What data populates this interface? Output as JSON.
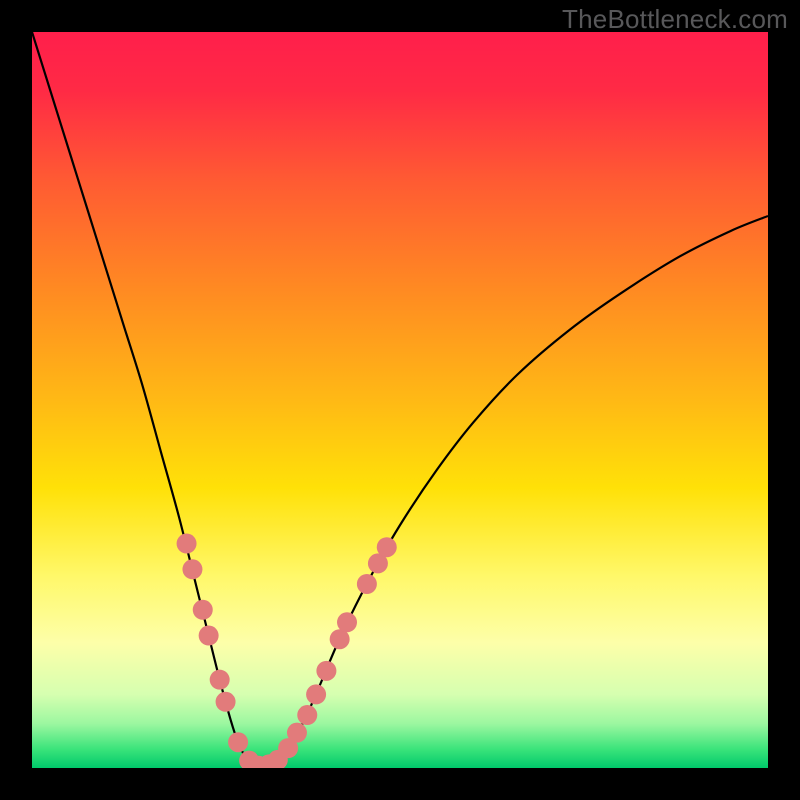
{
  "source_watermark": "TheBottleneck.com",
  "chart_data": {
    "type": "line",
    "title": "",
    "xlabel": "",
    "ylabel": "",
    "xlim": [
      0,
      100
    ],
    "ylim": [
      0,
      100
    ],
    "background_gradient_stops": [
      {
        "offset": 0.0,
        "color": "#ff1f4b"
      },
      {
        "offset": 0.08,
        "color": "#ff2a45"
      },
      {
        "offset": 0.2,
        "color": "#ff5a33"
      },
      {
        "offset": 0.35,
        "color": "#ff8a22"
      },
      {
        "offset": 0.5,
        "color": "#ffb915"
      },
      {
        "offset": 0.62,
        "color": "#ffe108"
      },
      {
        "offset": 0.74,
        "color": "#fff86a"
      },
      {
        "offset": 0.83,
        "color": "#fdffa9"
      },
      {
        "offset": 0.9,
        "color": "#d6ffb0"
      },
      {
        "offset": 0.94,
        "color": "#9bf7a0"
      },
      {
        "offset": 0.975,
        "color": "#39e37a"
      },
      {
        "offset": 1.0,
        "color": "#00c96b"
      }
    ],
    "series": [
      {
        "name": "bottleneck-curve",
        "color": "#000000",
        "stroke_width": 2.2,
        "x": [
          0.0,
          2.5,
          5.0,
          7.5,
          10.0,
          12.5,
          15.0,
          17.5,
          20.0,
          22.5,
          24.0,
          25.5,
          27.0,
          28.0,
          29.0,
          30.0,
          31.0,
          32.0,
          33.5,
          35.0,
          37.0,
          39.0,
          42.0,
          46.0,
          50.0,
          55.0,
          60.0,
          66.0,
          73.0,
          80.0,
          88.0,
          95.0,
          100.0
        ],
        "y": [
          100.0,
          92.0,
          84.0,
          76.0,
          68.0,
          60.0,
          52.0,
          43.0,
          34.0,
          24.0,
          18.0,
          12.0,
          6.5,
          3.5,
          1.5,
          0.5,
          0.2,
          0.4,
          1.2,
          3.0,
          6.5,
          11.0,
          18.0,
          26.0,
          33.0,
          40.5,
          47.0,
          53.5,
          59.5,
          64.5,
          69.5,
          73.0,
          75.0
        ]
      }
    ],
    "markers": {
      "name": "pink-dots",
      "color": "#e27b7b",
      "radius": 10,
      "points": [
        {
          "x": 21.0,
          "y": 30.5
        },
        {
          "x": 21.8,
          "y": 27.0
        },
        {
          "x": 23.2,
          "y": 21.5
        },
        {
          "x": 24.0,
          "y": 18.0
        },
        {
          "x": 25.5,
          "y": 12.0
        },
        {
          "x": 26.3,
          "y": 9.0
        },
        {
          "x": 28.0,
          "y": 3.5
        },
        {
          "x": 29.5,
          "y": 1.0
        },
        {
          "x": 30.8,
          "y": 0.3
        },
        {
          "x": 32.2,
          "y": 0.5
        },
        {
          "x": 33.4,
          "y": 1.1
        },
        {
          "x": 34.8,
          "y": 2.7
        },
        {
          "x": 36.0,
          "y": 4.8
        },
        {
          "x": 37.4,
          "y": 7.2
        },
        {
          "x": 38.6,
          "y": 10.0
        },
        {
          "x": 40.0,
          "y": 13.2
        },
        {
          "x": 41.8,
          "y": 17.5
        },
        {
          "x": 42.8,
          "y": 19.8
        },
        {
          "x": 45.5,
          "y": 25.0
        },
        {
          "x": 47.0,
          "y": 27.8
        },
        {
          "x": 48.2,
          "y": 30.0
        }
      ]
    }
  }
}
